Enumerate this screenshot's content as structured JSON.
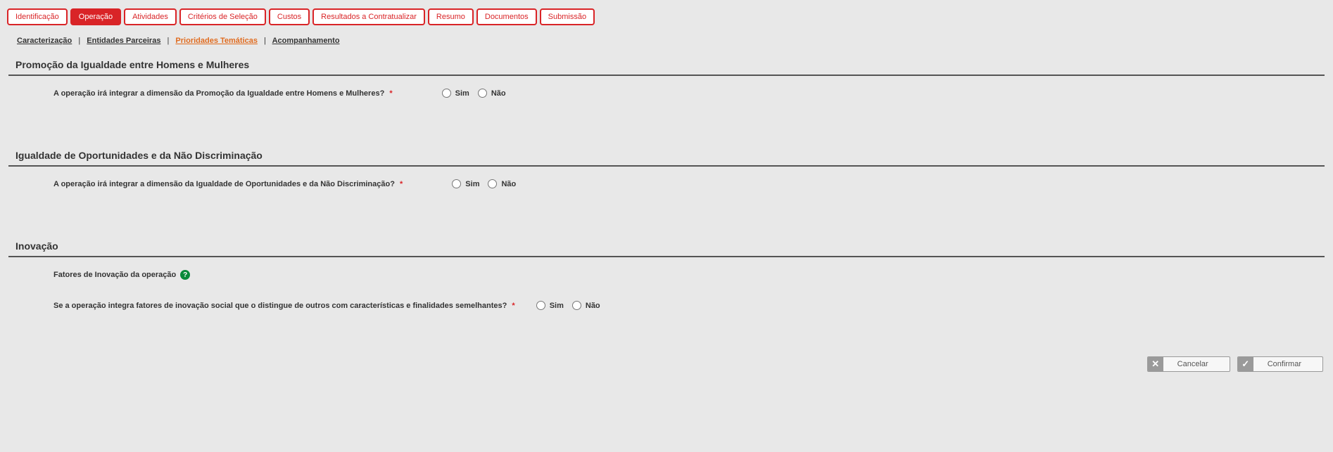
{
  "topTabs": {
    "t0": "Identificação",
    "t1": "Operação",
    "t2": "Atividades",
    "t3": "Critérios de Seleção",
    "t4": "Custos",
    "t5": "Resultados a Contratualizar",
    "t6": "Resumo",
    "t7": "Documentos",
    "t8": "Submissão"
  },
  "subTabs": {
    "s0": "Caracterização",
    "s1": "Entidades Parceiras",
    "s2": "Prioridades Temáticas",
    "s3": "Acompanhamento"
  },
  "sections": {
    "sec1_title": "Promoção da Igualdade entre Homens e Mulheres",
    "sec1_question": "A operação irá integrar a dimensão da Promoção da Igualdade entre Homens e Mulheres?",
    "sec2_title": "Igualdade de Oportunidades e da Não Discriminação",
    "sec2_question": "A operação irá integrar a dimensão da Igualdade de Oportunidades e da Não Discriminação?",
    "sec3_title": "Inovação",
    "sec3_sub": "Fatores de Inovação da operação",
    "sec3_question": "Se a operação integra fatores de inovação social que o distingue de outros com características e finalidades semelhantes?"
  },
  "options": {
    "yes": "Sim",
    "no": "Não"
  },
  "footer": {
    "cancel": "Cancelar",
    "confirm": "Confirmar"
  },
  "marks": {
    "required": "*"
  }
}
